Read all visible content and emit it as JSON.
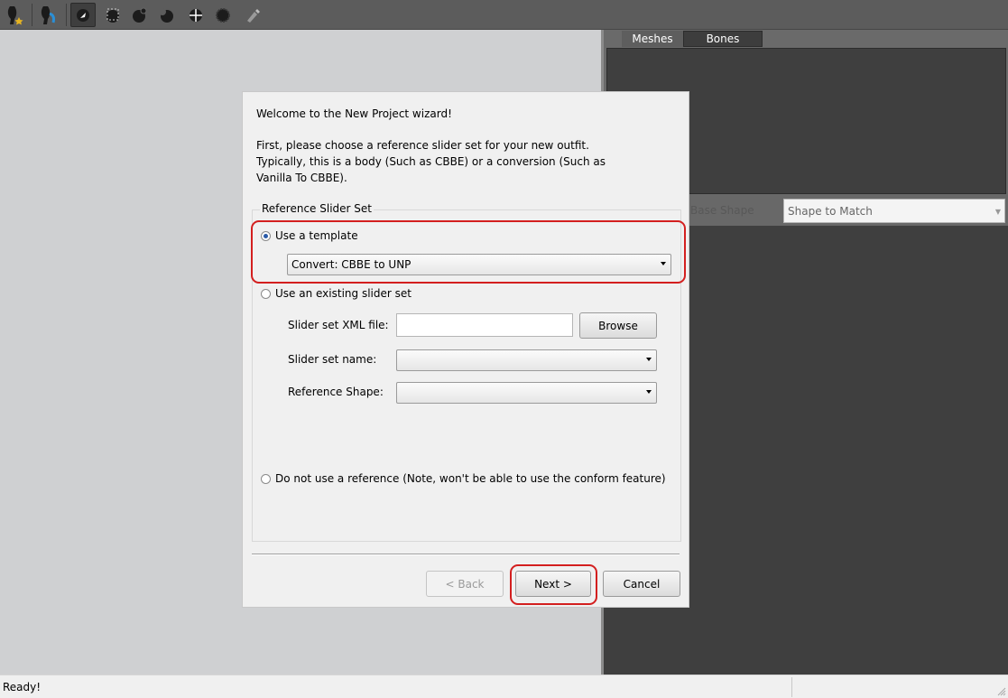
{
  "toolbar": {
    "tools": [
      "new-project-icon",
      "load-outfit-icon",
      "select-tool-icon",
      "mask-brush-icon",
      "inflate-brush-icon",
      "deflate-brush-icon",
      "move-brush-icon",
      "smooth-brush-icon",
      "weight-brush-icon"
    ],
    "active_tool": "select-tool-icon"
  },
  "right_panel": {
    "tabs": [
      "Meshes",
      "Bones"
    ],
    "shape_label": "Base Shape",
    "shape_select_value": "Shape to Match"
  },
  "dialog": {
    "intro_line1": "Welcome to the New Project wizard!",
    "intro_line2a": "First, please choose a reference slider set for your new outfit.",
    "intro_line2b": "Typically, this is a body (Such as CBBE) or a conversion (Such as",
    "intro_line2c": "Vanilla To CBBE).",
    "group_title": "Reference Slider Set",
    "option_template": "Use a template",
    "template_value": "Convert: CBBE to UNP",
    "option_existing": "Use an existing slider set",
    "xml_label": "Slider set XML file:",
    "xml_value": "",
    "browse_label": "Browse",
    "name_label": "Slider set name:",
    "name_value": "",
    "ref_shape_label": "Reference Shape:",
    "ref_shape_value": "",
    "option_none": "Do not use a reference  (Note, won't be able to use the conform feature)",
    "back_label": "< Back",
    "next_label": "Next >",
    "cancel_label": "Cancel"
  },
  "status": {
    "text": "Ready!"
  },
  "colors": {
    "highlight": "#d31f1f",
    "viewport": "#cfd0d2",
    "panel_dark": "#3f3f3f"
  }
}
